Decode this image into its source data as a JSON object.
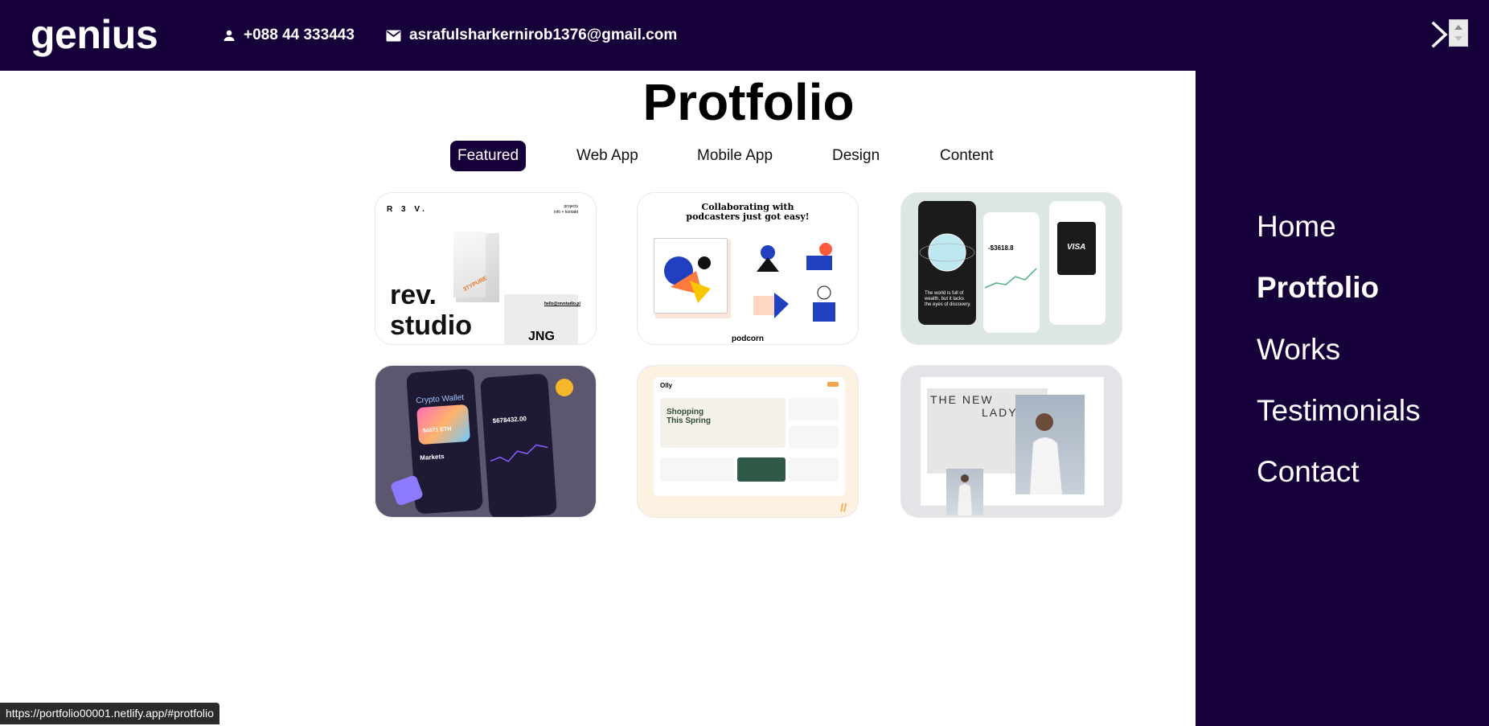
{
  "header": {
    "logo": "genius",
    "phone": "+088 44 333443",
    "email": "asrafulsharkernirob1376@gmail.com",
    "phone_icon": "person-icon",
    "email_icon": "mail-icon",
    "menu_toggle_icon": "chevron-right-icon"
  },
  "nav": {
    "items": [
      {
        "label": "Home",
        "active": false
      },
      {
        "label": "Protfolio",
        "active": true
      },
      {
        "label": "Works",
        "active": false
      },
      {
        "label": "Testimonials",
        "active": false
      },
      {
        "label": "Contact",
        "active": false
      }
    ]
  },
  "portfolio": {
    "title": "Protfolio",
    "filters": [
      {
        "label": "Featured",
        "active": true
      },
      {
        "label": "Web App",
        "active": false
      },
      {
        "label": "Mobile App",
        "active": false
      },
      {
        "label": "Design",
        "active": false
      },
      {
        "label": "Content",
        "active": false
      }
    ],
    "cards": [
      {
        "brand": "R 3 V.",
        "top_right": "projects\ninfo + kontakt",
        "sticker": "3TYPURE",
        "big_text": "rev.\nstudio",
        "contact": "hello@revstudio.pl",
        "sign": "JNG"
      },
      {
        "headline": "Collaborating with\npodcasters just got easy!",
        "footer": "podcorn"
      },
      {
        "amount": "-$3618.8",
        "tagline": "The world is full of wealth, but it lacks the eyes of discovery.",
        "card_brand": "VISA"
      },
      {
        "title": "Crypto Wallet",
        "balance": "$4671 ETH",
        "section": "Markets",
        "value": "$678432.00"
      },
      {
        "logo": "Olly",
        "headline": "Shopping\nThis Spring"
      },
      {
        "headline_1": "THE NEW",
        "headline_2": "LADY"
      }
    ]
  },
  "status_bar": {
    "url": "https://portfolio00001.netlify.app/#protfolio"
  },
  "colors": {
    "brand_dark": "#15003a",
    "white": "#ffffff"
  }
}
